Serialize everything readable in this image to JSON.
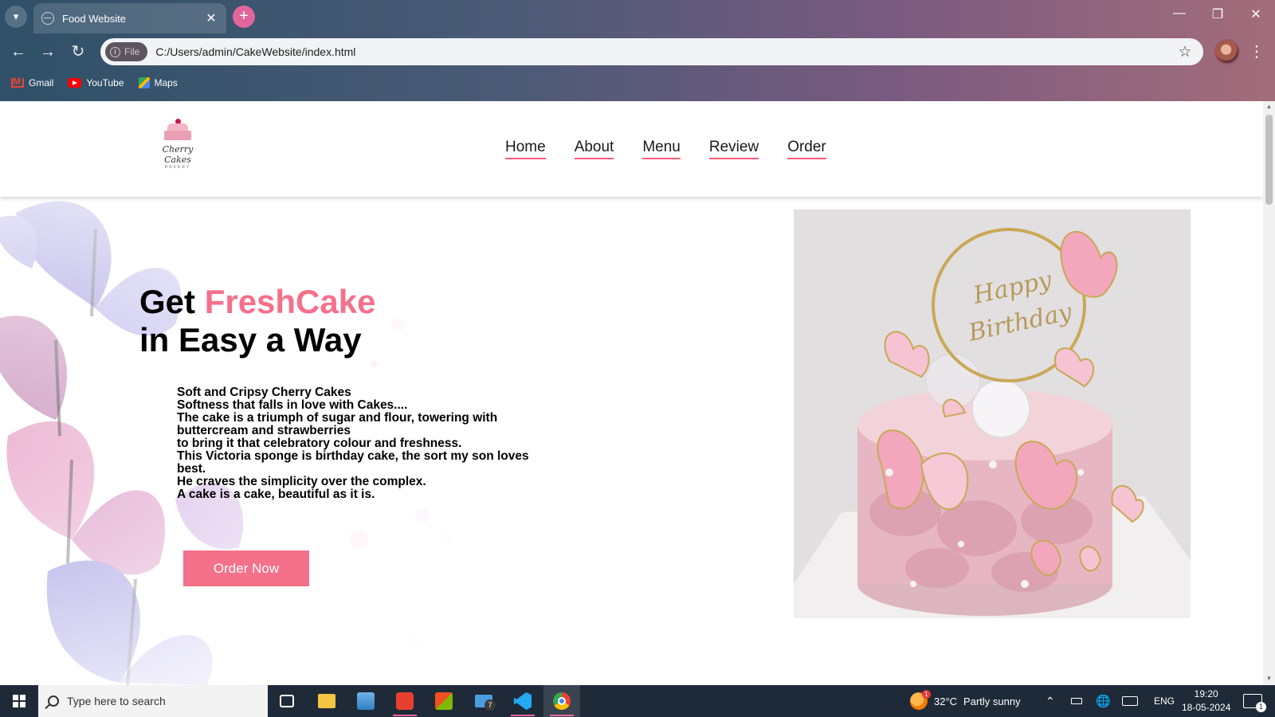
{
  "browser": {
    "tab_title": "Food Website",
    "tab_close": "✕",
    "new_tab": "+",
    "url_chip": "File",
    "url": "C:/Users/admin/CakeWebsite/index.html",
    "bookmarks": [
      {
        "label": "Gmail",
        "icon": "gmail-icon"
      },
      {
        "label": "YouTube",
        "icon": "youtube-icon"
      },
      {
        "label": "Maps",
        "icon": "maps-icon"
      }
    ],
    "window_controls": {
      "minimize": "—",
      "restore": "❐",
      "close": "✕"
    }
  },
  "site": {
    "logo": {
      "text": "Cherry Cakes",
      "sub": "BAKERY"
    },
    "nav": [
      "Home",
      "About",
      "Menu",
      "Review",
      "Order"
    ],
    "hero": {
      "title_part1": "Get ",
      "title_accent": "FreshCake",
      "title_line2": "in Easy a Way",
      "description": [
        "Soft and Cripsy Cherry Cakes",
        "Softness that falls in love with Cakes....",
        "The cake is a triumph of sugar and flour, towering with buttercream and strawberries",
        "to bring it that celebratory colour and freshness.",
        "This Victoria sponge is birthday cake, the sort my son loves best.",
        "He craves the simplicity over the complex.",
        "A cake is a cake, beautiful as it is."
      ],
      "button": "Order Now",
      "photo_text": [
        "Happy",
        "Birthday"
      ]
    }
  },
  "taskbar": {
    "search_placeholder": "Type here to search",
    "mail_badge": "7",
    "weather": {
      "temp": "32°C",
      "condition": "Partly sunny",
      "badge": "1"
    },
    "language": "ENG",
    "time": "19:20",
    "date": "18-05-2024",
    "notification_count": "1"
  },
  "colors": {
    "accent": "#f5708a",
    "nav_underline": "#ff5c7a"
  }
}
